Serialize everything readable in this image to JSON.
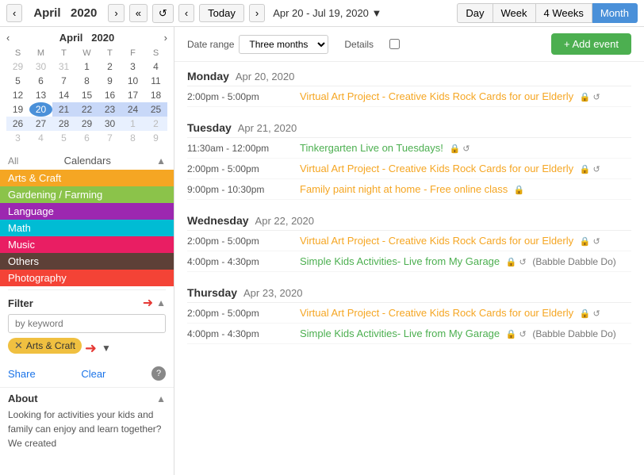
{
  "topbar": {
    "prev_month": "‹",
    "next_month": "›",
    "month": "April",
    "year": "2020",
    "double_left": "«",
    "refresh": "↺",
    "prev_range": "‹",
    "today": "Today",
    "next_range": "›",
    "date_range": "Apr 20 - Jul 19, 2020",
    "dropdown_arrow": "▼",
    "views": [
      "Day",
      "Week",
      "4 Weeks",
      "Month"
    ]
  },
  "mini_calendar": {
    "title_month": "April",
    "title_year": "2020",
    "weekdays": [
      "S",
      "M",
      "T",
      "W",
      "T",
      "F",
      "S"
    ],
    "weeks": [
      [
        {
          "d": "29",
          "o": true
        },
        {
          "d": "30",
          "o": true
        },
        {
          "d": "31",
          "o": true
        },
        {
          "d": "1"
        },
        {
          "d": "2"
        },
        {
          "d": "3"
        },
        {
          "d": "4"
        }
      ],
      [
        {
          "d": "5"
        },
        {
          "d": "6"
        },
        {
          "d": "7"
        },
        {
          "d": "8"
        },
        {
          "d": "9"
        },
        {
          "d": "10"
        },
        {
          "d": "11"
        }
      ],
      [
        {
          "d": "12"
        },
        {
          "d": "13"
        },
        {
          "d": "14"
        },
        {
          "d": "15"
        },
        {
          "d": "16"
        },
        {
          "d": "17"
        },
        {
          "d": "18"
        }
      ],
      [
        {
          "d": "19"
        },
        {
          "d": "20",
          "today": true
        },
        {
          "d": "21",
          "sel": true
        },
        {
          "d": "22",
          "sel": true
        },
        {
          "d": "23",
          "sel": true
        },
        {
          "d": "24",
          "sel": true
        },
        {
          "d": "25",
          "sel": true
        }
      ],
      [
        {
          "d": "26",
          "sel": true
        },
        {
          "d": "27",
          "sel": true
        },
        {
          "d": "28",
          "sel": true
        },
        {
          "d": "29",
          "sel": true
        },
        {
          "d": "30",
          "sel": true
        },
        {
          "d": "1",
          "o": true
        },
        {
          "d": "2",
          "o": true
        }
      ],
      [
        {
          "d": "3",
          "o": true
        },
        {
          "d": "4",
          "o": true
        },
        {
          "d": "5",
          "o": true
        },
        {
          "d": "6",
          "o": true
        },
        {
          "d": "7",
          "o": true
        },
        {
          "d": "8",
          "o": true
        },
        {
          "d": "9",
          "o": true
        }
      ]
    ]
  },
  "sidebar": {
    "all_label": "All",
    "calendars_title": "Calendars",
    "calendars": [
      {
        "label": "Arts & Craft",
        "class": "arts"
      },
      {
        "label": "Gardening / Farming",
        "class": "gardening"
      },
      {
        "label": "Language",
        "class": "language"
      },
      {
        "label": "Math",
        "class": "math"
      },
      {
        "label": "Music",
        "class": "music"
      },
      {
        "label": "Others",
        "class": "others"
      },
      {
        "label": "Photography",
        "class": "photography"
      }
    ],
    "filter_title": "Filter",
    "filter_placeholder": "by keyword",
    "filter_tag": "Arts & Craft",
    "share": "Share",
    "clear": "Clear",
    "about_title": "About",
    "about_text": "Looking for activities your kids and family can enjoy and learn together? We created"
  },
  "details_bar": {
    "date_range_label": "Date range",
    "date_range_value": "Three months",
    "details_label": "Details",
    "add_event": "+ Add event"
  },
  "days": [
    {
      "name": "Monday",
      "date": "Apr 20, 2020",
      "events": [
        {
          "time": "2:00pm - 5:00pm",
          "title": "Virtual Art Project - Creative Kids Rock Cards for our Elderly",
          "color": "orange",
          "icons": "🔒 ↺"
        }
      ]
    },
    {
      "name": "Tuesday",
      "date": "Apr 21, 2020",
      "events": [
        {
          "time": "11:30am - 12:00pm",
          "title": "Tinkergarten Live on Tuesdays!",
          "color": "green",
          "icons": "🔒 ↺"
        },
        {
          "time": "2:00pm - 5:00pm",
          "title": "Virtual Art Project - Creative Kids Rock Cards for our Elderly",
          "color": "orange",
          "icons": "🔒 ↺"
        },
        {
          "time": "9:00pm - 10:30pm",
          "title": "Family paint night at home - Free online class",
          "color": "orange",
          "icons": "🔒"
        }
      ]
    },
    {
      "name": "Wednesday",
      "date": "Apr 22, 2020",
      "events": [
        {
          "time": "2:00pm - 5:00pm",
          "title": "Virtual Art Project - Creative Kids Rock Cards for our Elderly",
          "color": "orange",
          "icons": "🔒 ↺"
        },
        {
          "time": "4:00pm - 4:30pm",
          "title": "Simple Kids Activities- Live from My Garage",
          "color": "green",
          "icons": "🔒 ↺",
          "source": "(Babble Dabble Do)"
        }
      ]
    },
    {
      "name": "Thursday",
      "date": "Apr 23, 2020",
      "events": [
        {
          "time": "2:00pm - 5:00pm",
          "title": "Virtual Art Project - Creative Kids Rock Cards for our Elderly",
          "color": "orange",
          "icons": "🔒 ↺"
        },
        {
          "time": "4:00pm - 4:30pm",
          "title": "Simple Kids Activities- Live from My Garage",
          "color": "green",
          "icons": "🔒 ↺",
          "source": "(Babble Dabble Do)"
        }
      ]
    }
  ]
}
